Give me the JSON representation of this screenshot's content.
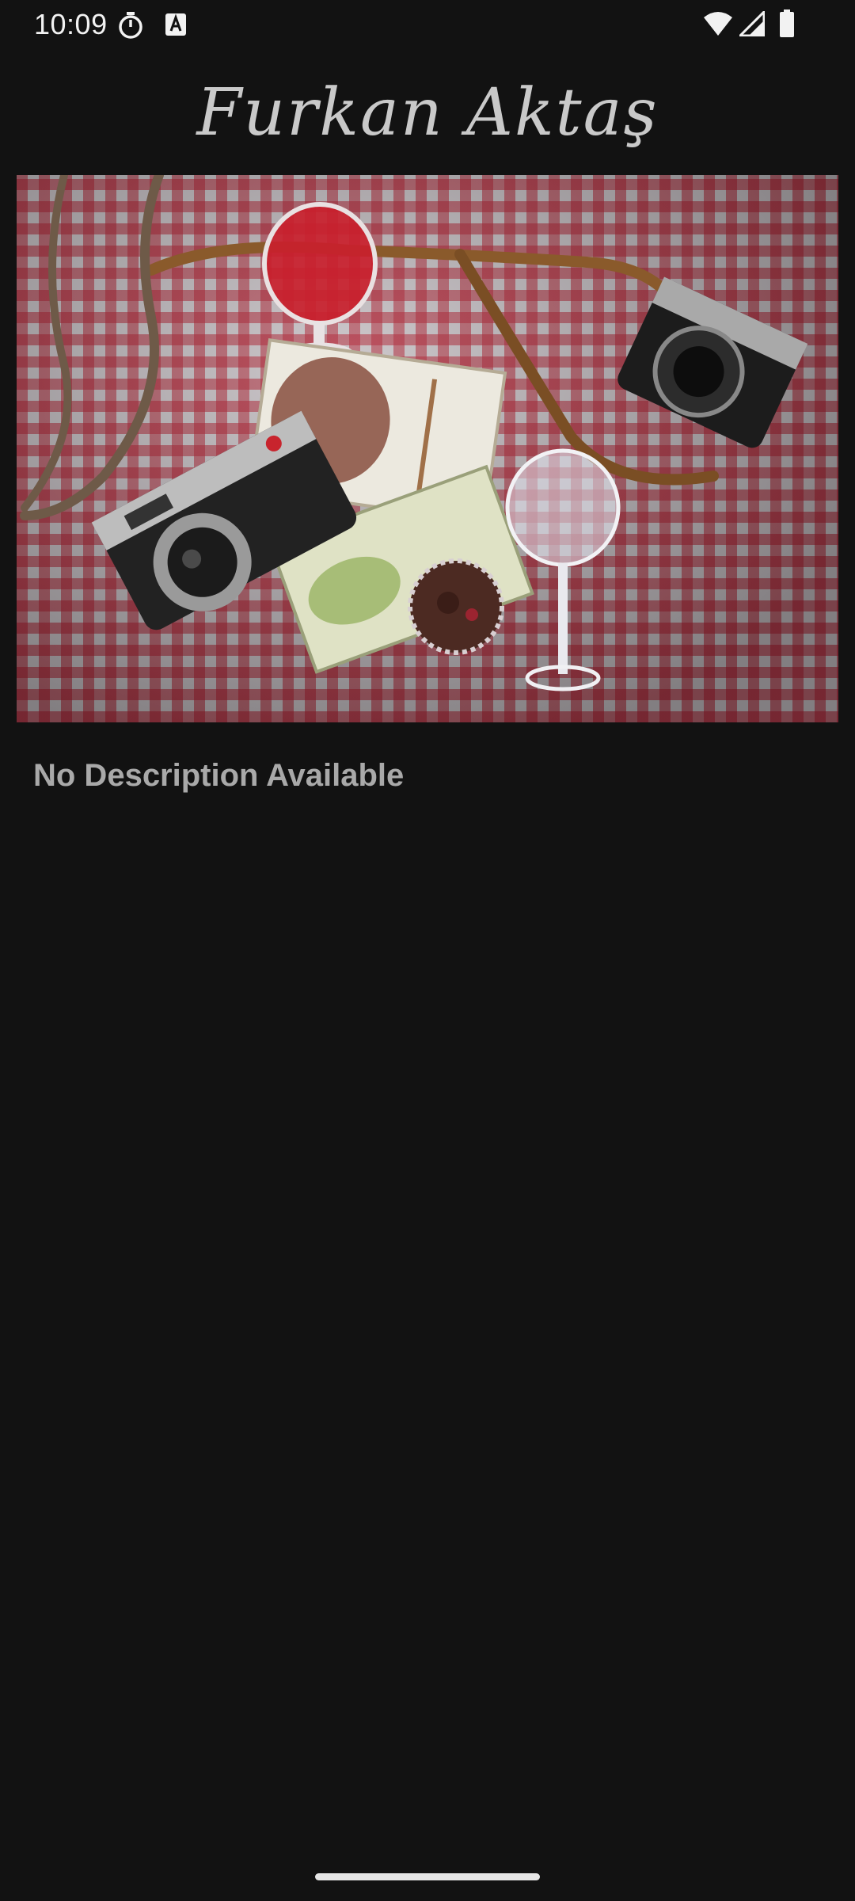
{
  "status_bar": {
    "time": "10:09",
    "icons": [
      "stopwatch-icon",
      "font-a-icon",
      "wifi-icon",
      "signal-icon",
      "battery-icon"
    ]
  },
  "header": {
    "title": "Furkan Aktaş"
  },
  "photo": {
    "subject": "cameras-books-wine-on-checkered-cloth"
  },
  "content": {
    "description": "No Description Available"
  },
  "colors": {
    "background": "#121212",
    "text": "#a9a9a9",
    "cloth_red": "#b01a2c"
  }
}
